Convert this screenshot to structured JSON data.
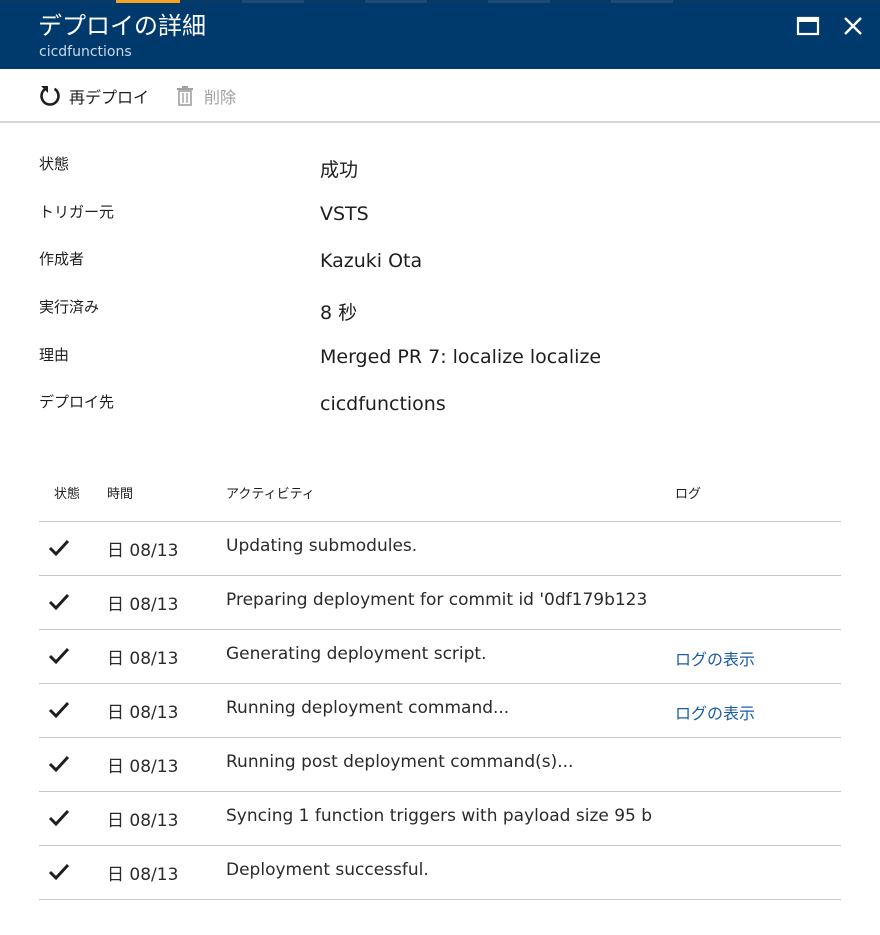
{
  "header": {
    "title": "デプロイの詳細",
    "subtitle": "cicdfunctions"
  },
  "toolbar": {
    "redeploy_label": "再デプロイ",
    "delete_label": "削除"
  },
  "properties": [
    {
      "label": "状態",
      "value": "成功"
    },
    {
      "label": "トリガー元",
      "value": "VSTS"
    },
    {
      "label": "作成者",
      "value": "Kazuki Ota"
    },
    {
      "label": "実行済み",
      "value": "8 秒"
    },
    {
      "label": "理由",
      "value": "Merged PR 7: localize localize"
    },
    {
      "label": "デプロイ先",
      "value": "cicdfunctions"
    }
  ],
  "table": {
    "columns": {
      "status": "状態",
      "time": "時間",
      "activity": "アクティビティ",
      "log": "ログ"
    },
    "rows": [
      {
        "time": "日 08/13",
        "activity": "Updating submodules.",
        "log": ""
      },
      {
        "time": "日 08/13",
        "activity": "Preparing deployment for commit id '0df179b123",
        "log": ""
      },
      {
        "time": "日 08/13",
        "activity": "Generating deployment script.",
        "log": "ログの表示"
      },
      {
        "time": "日 08/13",
        "activity": "Running deployment command...",
        "log": "ログの表示"
      },
      {
        "time": "日 08/13",
        "activity": "Running post deployment command(s)...",
        "log": ""
      },
      {
        "time": "日 08/13",
        "activity": "Syncing 1 function triggers with payload size 95 b",
        "log": ""
      },
      {
        "time": "日 08/13",
        "activity": "Deployment successful.",
        "log": ""
      }
    ]
  },
  "colors": {
    "header_bg": "#003a6c",
    "accent_tab": "#f7a223",
    "link": "#1a5ea8"
  }
}
